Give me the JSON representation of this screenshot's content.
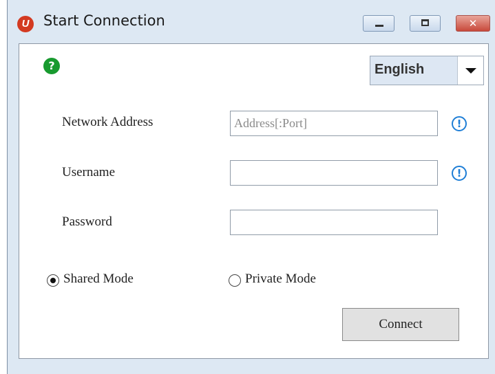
{
  "window": {
    "title": "Start Connection",
    "app_icon_text": "U",
    "controls": {
      "minimize": "minimize",
      "maximize": "maximize",
      "close": "✕"
    }
  },
  "help": {
    "glyph": "?"
  },
  "language": {
    "selected": "English"
  },
  "form": {
    "network_address": {
      "label": "Network Address",
      "value": "",
      "placeholder": "Address[:Port]",
      "info": "!"
    },
    "username": {
      "label": "Username",
      "value": "",
      "info": "!"
    },
    "password": {
      "label": "Password",
      "value": ""
    }
  },
  "mode": {
    "options": [
      {
        "label": "Shared Mode",
        "selected": true
      },
      {
        "label": "Private Mode",
        "selected": false
      }
    ]
  },
  "actions": {
    "connect": "Connect"
  },
  "colors": {
    "help_icon": "#189a2f",
    "info_icon": "#1e7ed6",
    "close_button": "#c8493b",
    "app_icon": "#d33a21"
  },
  "icons": {
    "app": "app-logo-icon",
    "help": "help-icon",
    "info": "info-icon",
    "dropdown": "chevron-down-icon"
  }
}
